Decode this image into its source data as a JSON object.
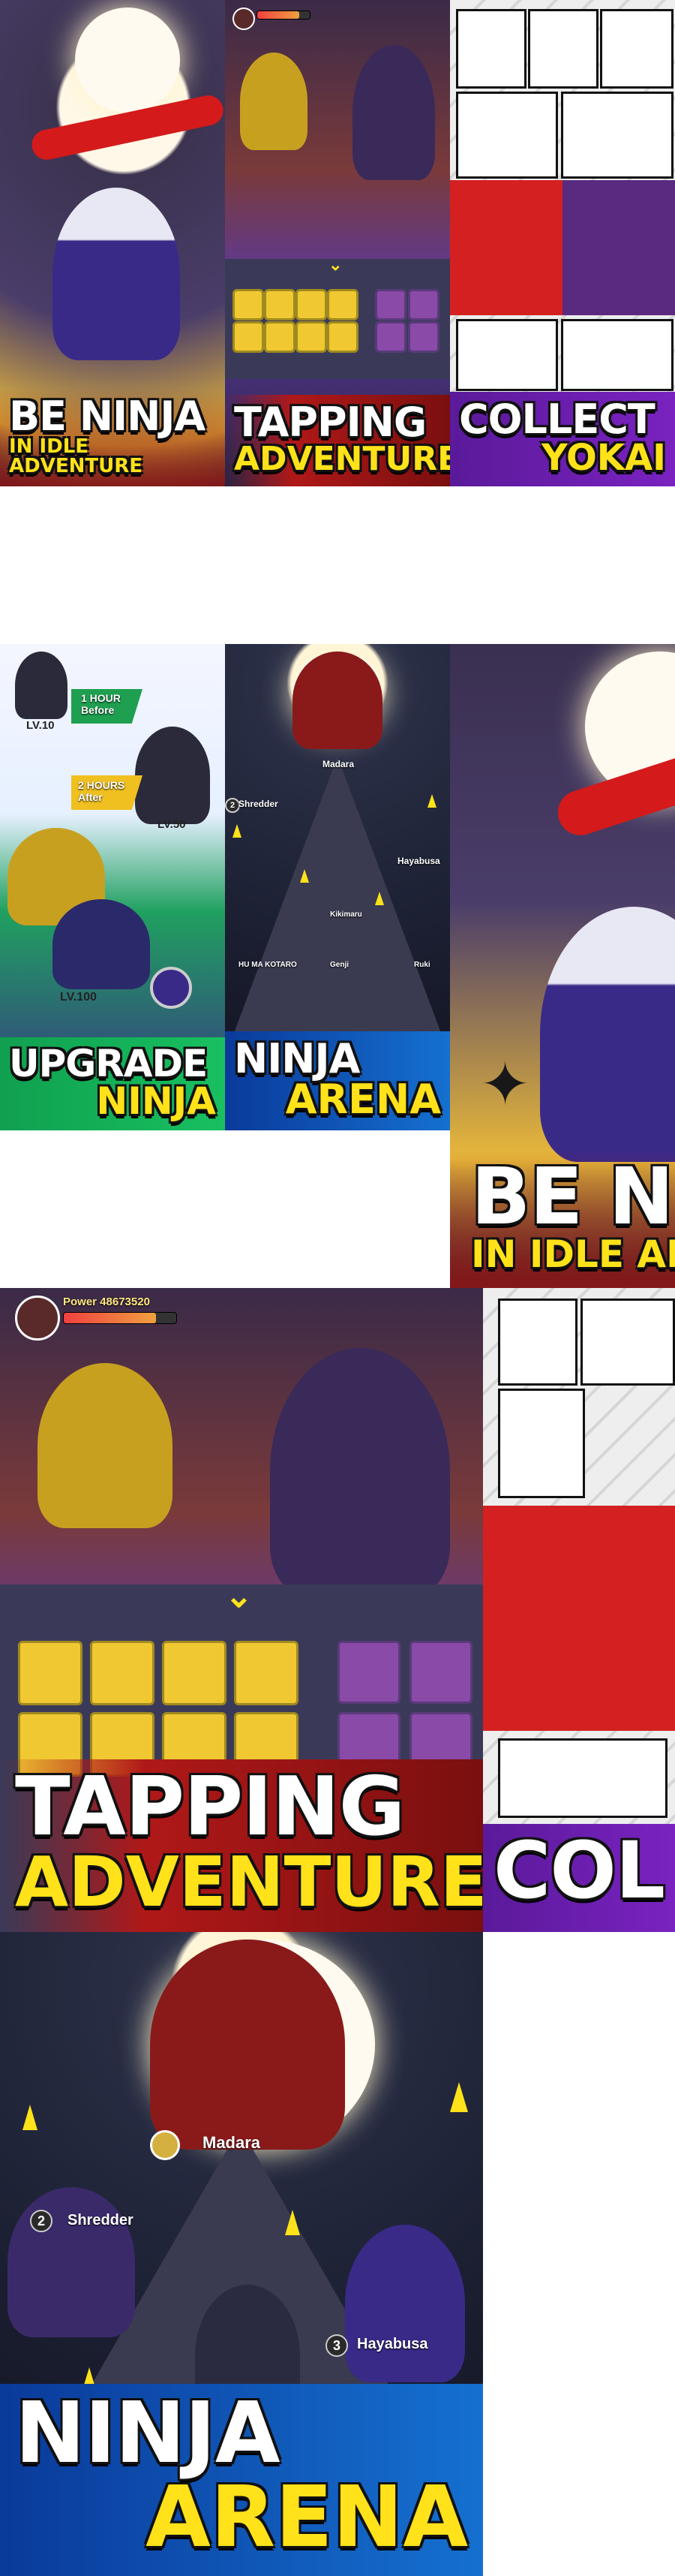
{
  "panels": {
    "be_ninja_small": {
      "line1": "BE NINJA",
      "line2": "IN IDLE ADVENTURE"
    },
    "tapping_small": {
      "line1": "TAPPING",
      "line2": "ADVENTURE"
    },
    "collect_small": {
      "line1": "COLLECT",
      "line2": "YOKAI"
    },
    "upgrade": {
      "line1": "UPGRADE",
      "line2": "NINJA",
      "before_label": "1 HOUR\nBefore",
      "after_label": "2 HOURS\nAfter",
      "lv_a": "LV.10",
      "lv_b": "LV.50",
      "lv_c": "LV.100"
    },
    "arena_small": {
      "line1": "NINJA",
      "line2": "ARENA",
      "names": [
        "Madara",
        "Shredder",
        "Hayabusa",
        "Kikimaru",
        "HU MA KOTARO",
        "Genji",
        "Ruki"
      ]
    },
    "be_ninja_large": {
      "line1": "BE N",
      "line2": "IN IDLE AD"
    },
    "tapping_large": {
      "line1": "TAPPING",
      "line2": "ADVENTURE",
      "power": "Power 48673520"
    },
    "collect_large": {
      "line1": "COL"
    },
    "arena_large": {
      "line1": "NINJA",
      "line2": "ARENA",
      "name1": "Madara",
      "num2": "2",
      "name2": "Shredder",
      "num3": "3",
      "name3": "Hayabusa"
    }
  }
}
